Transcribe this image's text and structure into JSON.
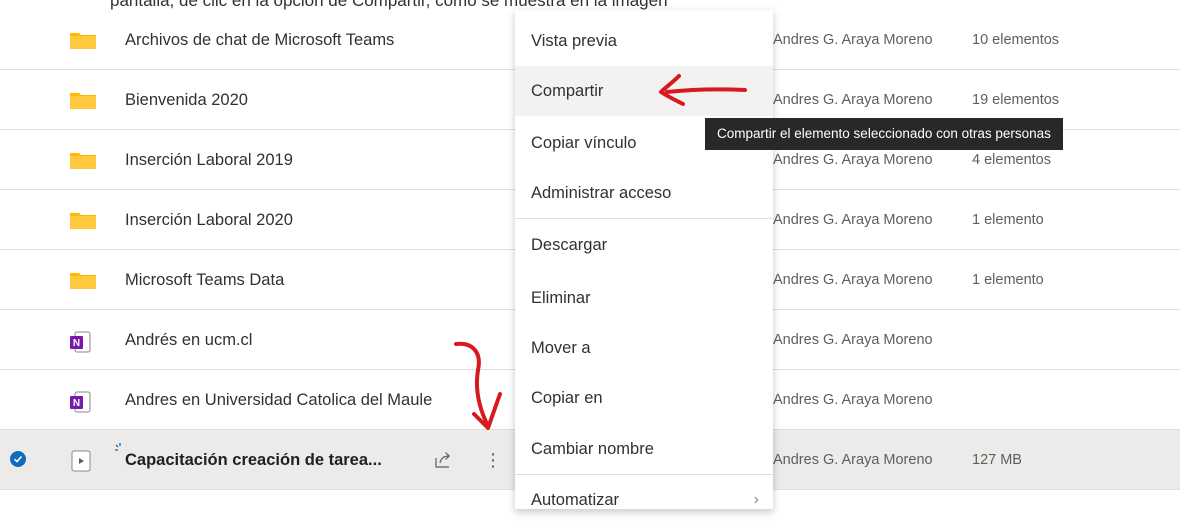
{
  "top_strip_text": "pantalla, de clic en la opción de Compartir, como se muestra en la imagen",
  "files": [
    {
      "name": "Archivos de chat de Microsoft Teams",
      "type": "folder",
      "owner": "Andres G. Araya Moreno",
      "size": "10 elementos",
      "selected": false
    },
    {
      "name": "Bienvenida 2020",
      "type": "folder",
      "owner": "Andres G. Araya Moreno",
      "size": "19 elementos",
      "selected": false
    },
    {
      "name": "Inserción Laboral 2019",
      "type": "folder",
      "owner": "Andres G. Araya Moreno",
      "size": "4 elementos",
      "selected": false
    },
    {
      "name": "Inserción Laboral 2020",
      "type": "folder",
      "owner": "Andres G. Araya Moreno",
      "size": "1 elemento",
      "selected": false
    },
    {
      "name": "Microsoft Teams Data",
      "type": "folder",
      "owner": "Andres G. Araya Moreno",
      "size": "1 elemento",
      "selected": false
    },
    {
      "name": "Andrés en ucm.cl",
      "type": "onenote",
      "owner": "Andres G. Araya Moreno",
      "size": "",
      "selected": false
    },
    {
      "name": "Andres en Universidad Catolica del Maule",
      "type": "onenote",
      "owner": "Andres G. Araya Moreno",
      "size": "",
      "selected": false
    },
    {
      "name": "Capacitación creación de tarea...",
      "type": "video",
      "owner": "Andres G. Araya Moreno",
      "size": "127 MB",
      "selected": true
    }
  ],
  "context_menu": {
    "items": [
      {
        "label": "Vista previa"
      },
      {
        "label": "Compartir"
      },
      {
        "label": "Copiar vínculo"
      },
      {
        "label": "Administrar acceso"
      },
      {
        "label": "Descargar"
      },
      {
        "label": "Eliminar"
      },
      {
        "label": "Mover a"
      },
      {
        "label": "Copiar en"
      },
      {
        "label": "Cambiar nombre"
      },
      {
        "label": "Automatizar"
      }
    ],
    "hovered": "Compartir"
  },
  "tooltip": "Compartir el elemento seleccionado con otras personas",
  "colors": {
    "folder": "#ffb900",
    "onenote": "#7719aa",
    "accent": "#0f6cbd",
    "annotation": "#d71920"
  }
}
